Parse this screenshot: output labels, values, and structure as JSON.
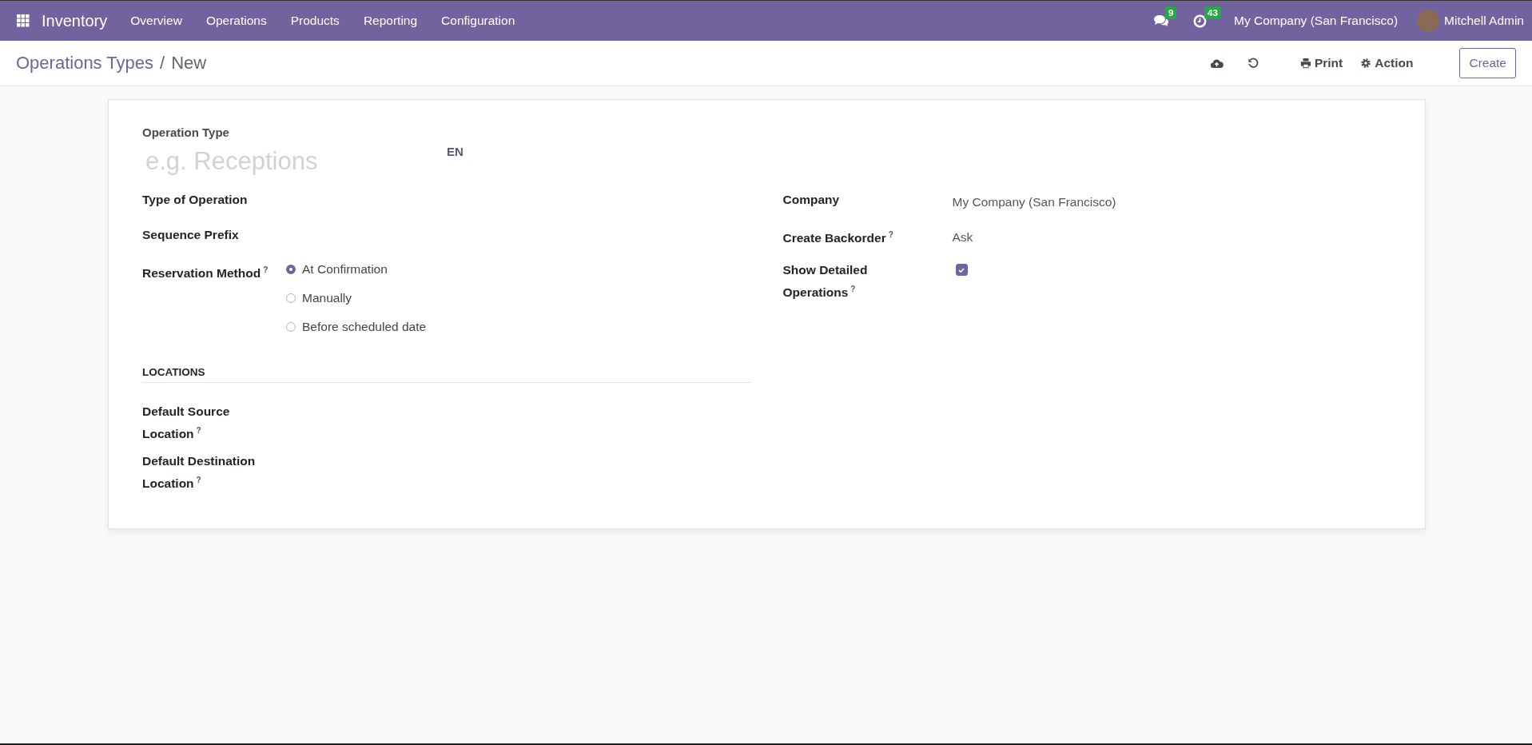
{
  "navbar": {
    "app_name": "Inventory",
    "menu": [
      "Overview",
      "Operations",
      "Products",
      "Reporting",
      "Configuration"
    ],
    "messages_count": "9",
    "activities_count": "43",
    "company": "My Company (San Francisco)",
    "user": "Mitchell Admin"
  },
  "breadcrumb": {
    "parent": "Operations Types",
    "separator": "/",
    "current": "New"
  },
  "actions": {
    "print": "Print",
    "action": "Action",
    "create": "Create"
  },
  "form": {
    "title": {
      "label": "Operation Type",
      "placeholder": "e.g. Receptions",
      "lang": "EN"
    },
    "left_fields": [
      {
        "label": "Type of Operation"
      },
      {
        "label": "Sequence Prefix"
      },
      {
        "kind": "radio",
        "label": "Reservation Method",
        "help": "?",
        "options": [
          {
            "label": "At Confirmation",
            "selected": true
          },
          {
            "label": "Manually",
            "selected": false
          },
          {
            "label": "Before scheduled date",
            "selected": false
          }
        ]
      }
    ],
    "section": {
      "title": "LOCATIONS",
      "fields": [
        {
          "label": "Default Source Location",
          "help": "?"
        },
        {
          "label": "Default Destination Location",
          "help": "?"
        }
      ]
    },
    "right_fields": [
      {
        "kind": "text",
        "label": "Company",
        "value": "My Company (San Francisco)"
      },
      {
        "kind": "text",
        "label": "Create Backorder",
        "help": "?",
        "value": "Ask"
      },
      {
        "kind": "checkbox",
        "label": "Show Detailed Operations",
        "help": "?",
        "checked": true
      }
    ]
  }
}
